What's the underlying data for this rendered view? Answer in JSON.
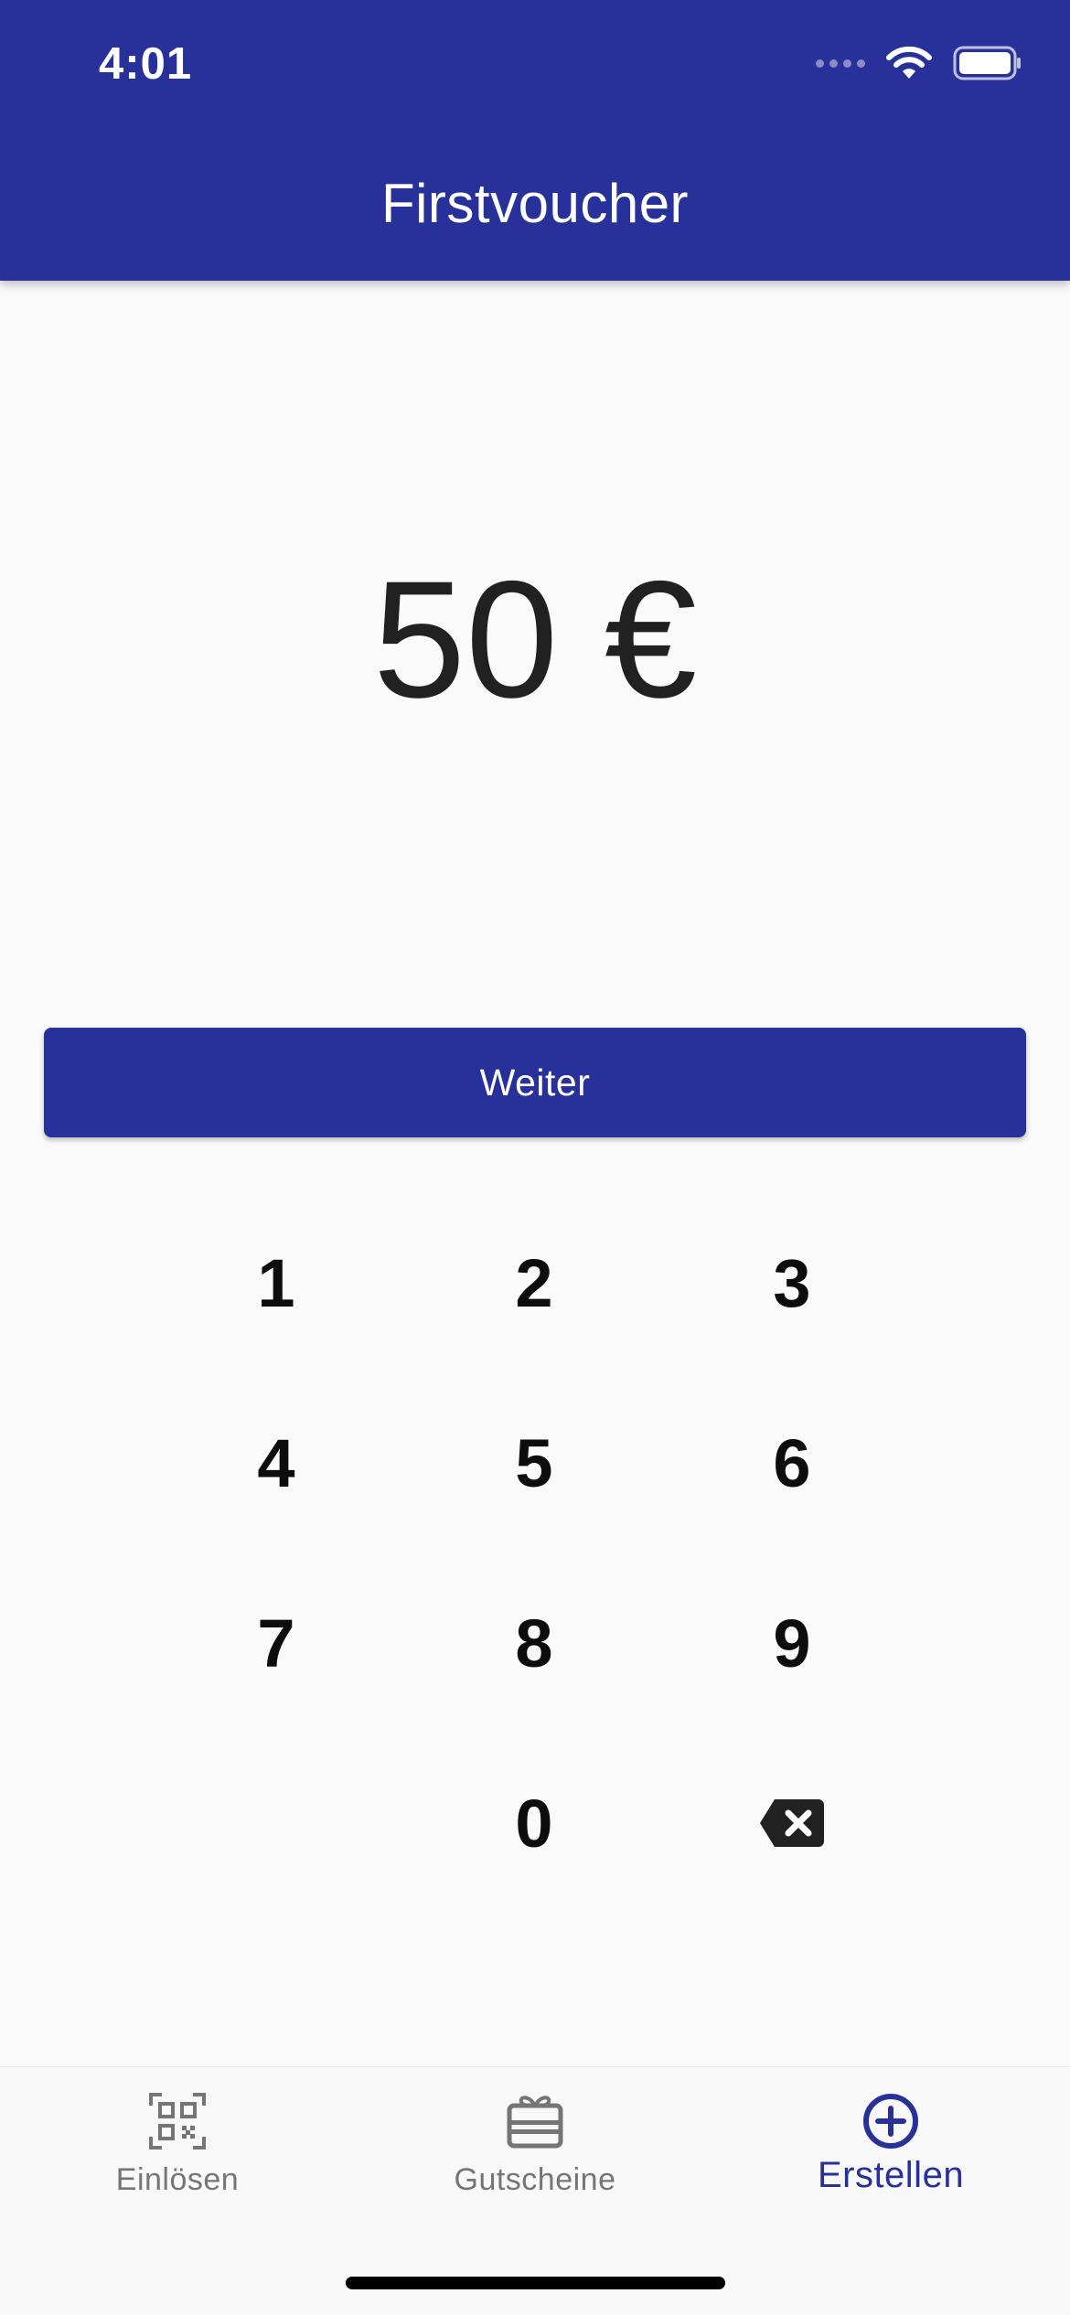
{
  "status_bar": {
    "time": "4:01"
  },
  "app_bar": {
    "title": "Firstvoucher",
    "color": "#283199"
  },
  "amount": {
    "display": "50 €"
  },
  "continue_button": {
    "label": "Weiter"
  },
  "keypad": {
    "keys": [
      "1",
      "2",
      "3",
      "4",
      "5",
      "6",
      "7",
      "8",
      "9",
      "0"
    ],
    "backspace_icon": "backspace-icon"
  },
  "bottom_nav": {
    "active_color": "#283199",
    "items": [
      {
        "label": "Einlösen",
        "icon": "qr-code-icon",
        "active": false
      },
      {
        "label": "Gutscheine",
        "icon": "gift-card-icon",
        "active": false
      },
      {
        "label": "Erstellen",
        "icon": "add-circle-icon",
        "active": true
      }
    ]
  }
}
